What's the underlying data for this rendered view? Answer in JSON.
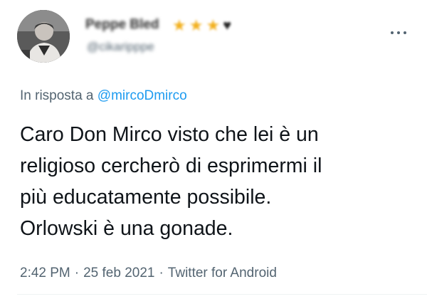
{
  "author": {
    "display_name": "Peppe Bled",
    "handle": "@cikaripppe",
    "badges": [
      "star-icon",
      "star-icon",
      "star-icon",
      "black-heart-icon"
    ]
  },
  "reply": {
    "prefix": "In risposta a ",
    "mention": "@mircoDmirco"
  },
  "tweet": {
    "text": "Caro Don Mirco visto che lei è un\nreligioso cercherò di esprimermi il\npiù educatamente possibile.\nOrlowski è una gonade."
  },
  "meta": {
    "time": "2:42 PM",
    "separator": "·",
    "date": "25 feb 2021",
    "source": "Twitter for Android"
  },
  "colors": {
    "text_primary": "#0f1419",
    "text_secondary": "#536471",
    "link": "#1d9bf0",
    "badge_star": "#f2b01e"
  }
}
